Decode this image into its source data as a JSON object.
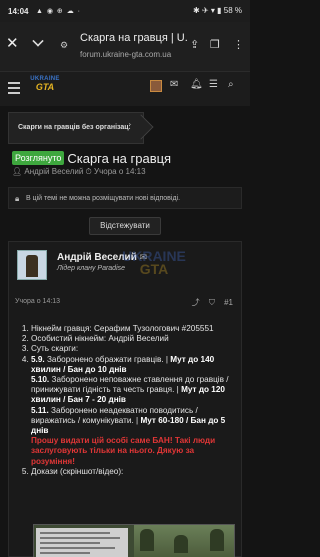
{
  "statusbar": {
    "time": "14:04",
    "left_icons": "▲ ◉ ⊕ ☁ ·",
    "right_icons": "✱ ✈ ▾ ▮",
    "battery": "58 %"
  },
  "browser": {
    "page_title": "Скарга на гравця | U...",
    "url": "forum.ukraine-gta.com.ua"
  },
  "site": {
    "logo_line1": "UKRAINE",
    "logo_line2": "GTA"
  },
  "breadcrumb": {
    "label": "Скарги на гравців без організації"
  },
  "thread": {
    "status_badge": "Розглянуто",
    "title": "Скарга на гравця",
    "author": "Андрій Веселий",
    "date": "Учора о 14:13",
    "notice": "В цій темі не можна розміщувати нові відповіді.",
    "watch_button": "Відстежувати"
  },
  "post": {
    "author": "Андрій Веселий",
    "role": "Лідер клану Paradise",
    "watermark_line1": "UKRAINE",
    "watermark_line2": "GTA",
    "date": "Учора о 14:13",
    "number": "#1",
    "items": {
      "i1": "Нікнейм гравця: Серафим Тузологович #205551",
      "i2": "Особистий нікнейм: Андрій Веселий",
      "i3": "Суть скарги:",
      "i4_a": "5.9.",
      "i4_b": " Заборонено ображати гравців. | ",
      "i4_c": "Мут до 140 хвилин / Бан до 10 днів",
      "i4_d": "5.10.",
      "i4_e": " Заборонено неповажне ставлення до гравців / принижувати гідність та честь гравця. | ",
      "i4_f": "Мут до 120 хвилин / Бан 7 - 20 днів",
      "i4_g": "5.11.",
      "i4_h": " Заборонено неадекватно поводитись / виражатись / комунікувати. | ",
      "i4_i": "Мут 60-180 / Бан до 5 днів",
      "i4_red": "Прошу видати цій особі саме БАН! Такі люди заслуговують тільки на нього. Дякую за розуміння!",
      "i5": "Докази (скріншот/відео):"
    }
  }
}
